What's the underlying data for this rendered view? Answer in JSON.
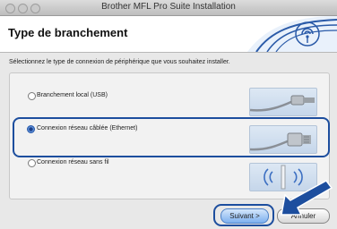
{
  "window": {
    "title": "Brother MFL Pro Suite Installation"
  },
  "header": {
    "heading": "Type de branchement"
  },
  "main": {
    "instruction": "Sélectionnez le type de connexion de périphérique que vous souhaitez installer.",
    "options": [
      {
        "label": "Branchement local (USB)",
        "selected": false,
        "icon": "usb-cable-icon"
      },
      {
        "label": "Connexion réseau câblée (Ethernet)",
        "selected": true,
        "icon": "ethernet-cable-icon"
      },
      {
        "label": "Connexion réseau sans fil",
        "selected": false,
        "icon": "wireless-icon"
      }
    ]
  },
  "buttons": {
    "next": "Suivant >",
    "cancel": "Annuler"
  },
  "colors": {
    "accent": "#1d4e9e",
    "header_wave": "#2a5aa8"
  }
}
